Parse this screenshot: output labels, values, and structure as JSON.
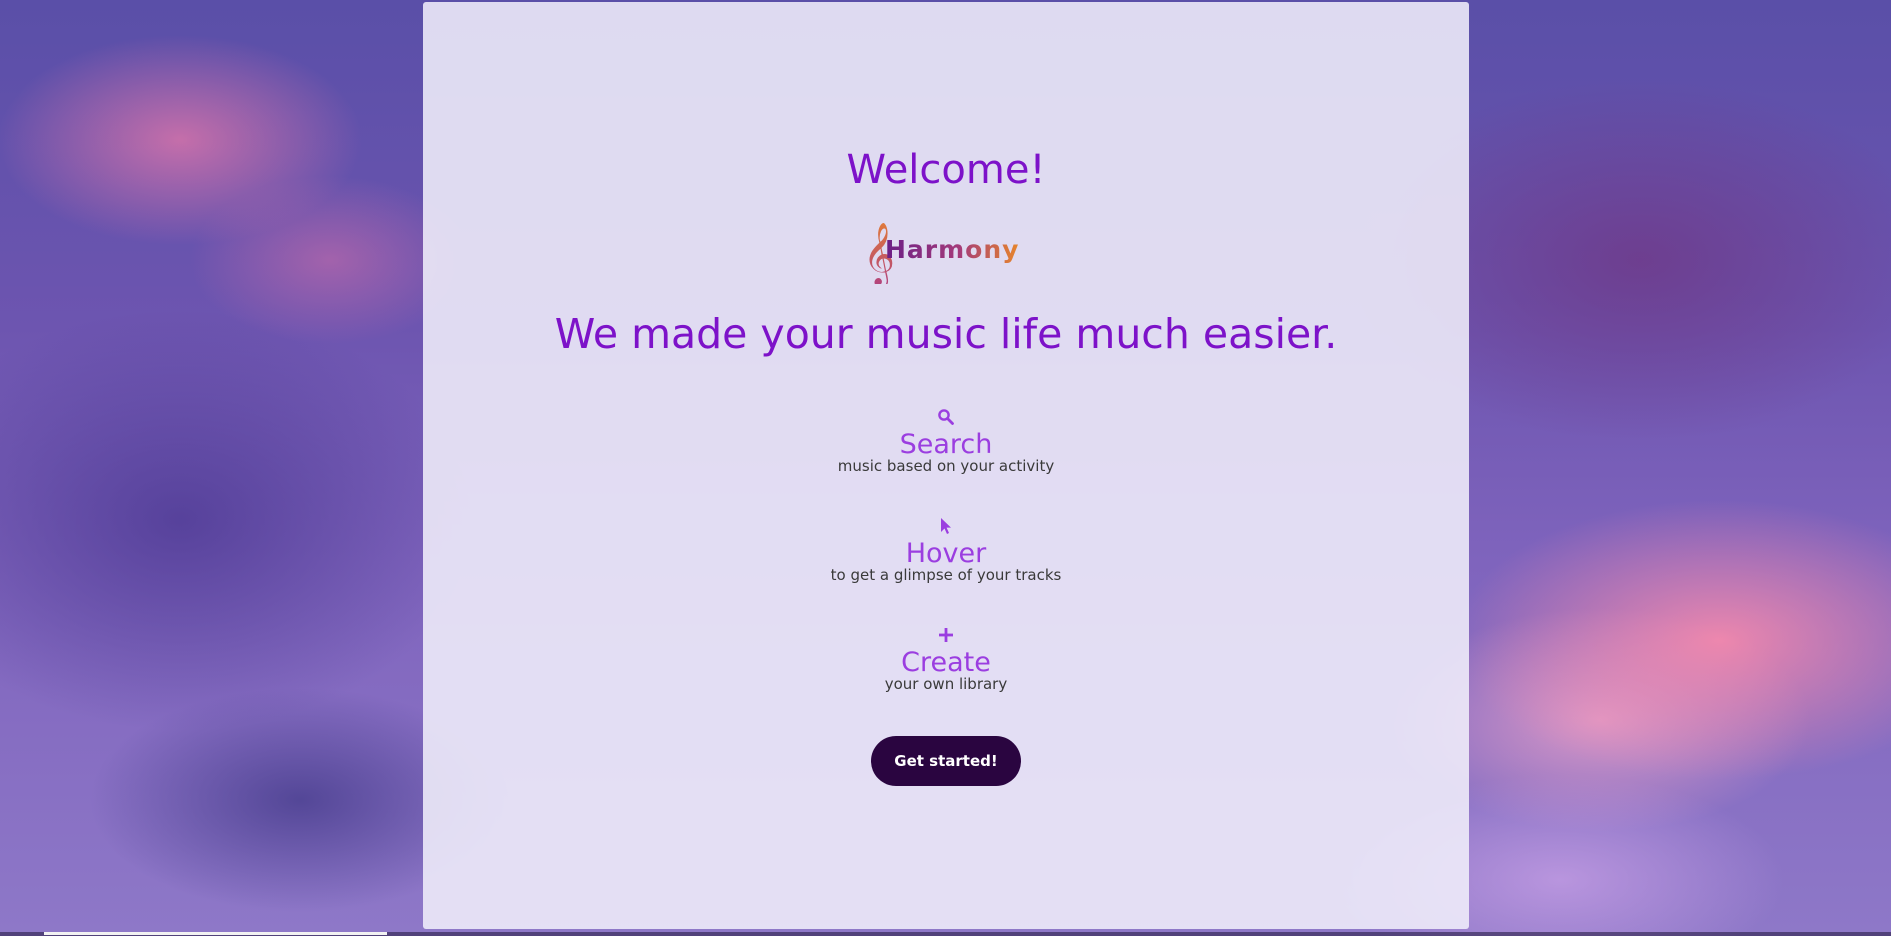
{
  "welcome": {
    "heading": "Welcome!"
  },
  "logo": {
    "text": "Harmony",
    "clef": "𝄞"
  },
  "tagline": "We made your music life much easier.",
  "features": [
    {
      "icon": "search-icon",
      "title": "Search",
      "description": "music based on your activity"
    },
    {
      "icon": "cursor-icon",
      "title": "Hover",
      "description": "to get a glimpse of your tracks"
    },
    {
      "icon": "plus-icon",
      "title": "Create",
      "description": "your own library"
    }
  ],
  "cta": {
    "label": "Get started!"
  },
  "colors": {
    "accent": "#7d12c9",
    "feature_title": "#9b3ee0",
    "button_bg": "#2a0540",
    "logo_purple": "#6b1f86",
    "logo_orange": "#e8862a"
  }
}
